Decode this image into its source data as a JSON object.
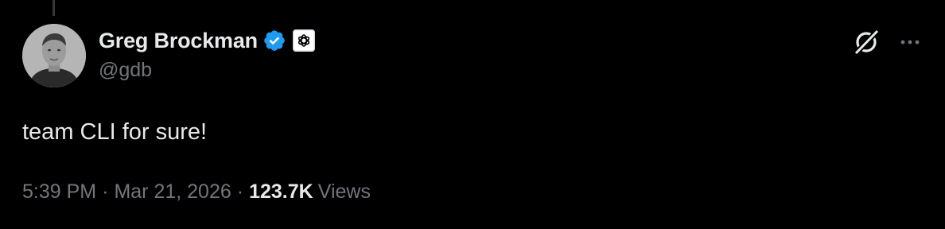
{
  "tweet": {
    "author": {
      "display_name": "Greg Brockman",
      "handle": "@gdb",
      "verified": true,
      "verified_icon": "verified-badge-icon",
      "affiliation_icon": "openai-logo-icon"
    },
    "text": "team CLI for sure!",
    "time": "5:39 PM",
    "separator": "·",
    "date": "Mar 21, 2026",
    "views_count": "123.7K",
    "views_label": "Views"
  },
  "actions": {
    "grok_icon": "grok-icon",
    "more_icon": "more-options-icon"
  },
  "colors": {
    "background": "#000000",
    "primary_text": "#e7e9ea",
    "secondary_text": "#71767b",
    "verified_blue": "#1d9bf0"
  }
}
